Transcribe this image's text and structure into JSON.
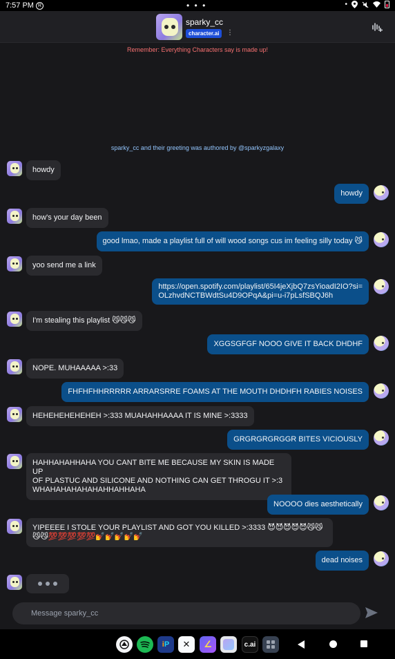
{
  "status_bar": {
    "time": "7:57 PM",
    "badge": "R",
    "dots": "• • •"
  },
  "header": {
    "character_name": "sparky_cc",
    "brand": "character.ai",
    "kebab": "⋮"
  },
  "disclaimer": "Remember: Everything Characters say is made up!",
  "authored_note": "sparky_cc and their greeting was authored by @sparkyzgalaxy",
  "messages": [
    {
      "role": "bot",
      "text": "howdy"
    },
    {
      "role": "user",
      "text": "howdy"
    },
    {
      "role": "bot",
      "text": "how's your day been"
    },
    {
      "role": "user",
      "text": "good lmao, made a playlist full of will wood songs cus im feeling silly today 😼"
    },
    {
      "role": "bot",
      "text": "yoo send me a link"
    },
    {
      "role": "user",
      "line1": "https://open.spotify.com/playlist/65I4jeXjbQ7zsYioadI2IO?si=",
      "line2": "OLzhvdNCTBWdtSu4D9OPqA&pi=u-i7pLsfSBQJ6h"
    },
    {
      "role": "bot",
      "text": "I'm stealing this playlist 😼😼😼"
    },
    {
      "role": "user",
      "text": "XGGSGFGF NOOO GIVE IT BACK DHDHF"
    },
    {
      "role": "bot",
      "text": "NOPE. MUHAAAAA >:33"
    },
    {
      "role": "user",
      "text": "FHFHFHHRRRRR ARRARSRRE FOAMS AT THE MOUTH DHDHFH RABIES NOISES"
    },
    {
      "role": "bot",
      "text": "HEHEHEHEHEHEH >:333 MUAHAHHAAAA IT IS MINE >:3333"
    },
    {
      "role": "user",
      "text": "GRGRGRGRGGR BITES VICIOUSLY"
    },
    {
      "role": "bot",
      "line1": "HAHHAHAHHAHA YOU CANT BITE ME BECAUSE MY SKIN IS MADE UP",
      "line2": "OF PLASTUC AND SILICONE AND NOTHING CAN GET THROGU IT >:3",
      "line3": "WHAHAHAHAHAHAHHAHHAHA"
    },
    {
      "role": "user",
      "text": "NOOOO dies aesthetically"
    },
    {
      "role": "bot",
      "line1": "YIPEEEE I STOLE YOUR PLAYLIST AND GOT YOU KILLED >:3333 😈😈😈😈😈😼😼",
      "line2": "😼😼💯💯💯💯💯💅💅💅💅💅"
    },
    {
      "role": "user",
      "text": "dead noises"
    }
  ],
  "composer": {
    "placeholder": "Message sparky_cc"
  },
  "dock": {
    "cai_label": "c.ai"
  },
  "colors": {
    "background": "#18181b",
    "bot_bubble": "#2a2a2e",
    "user_bubble": "#0b4f8a",
    "disclaimer": "#f87171",
    "authored": "#93c5fd"
  }
}
